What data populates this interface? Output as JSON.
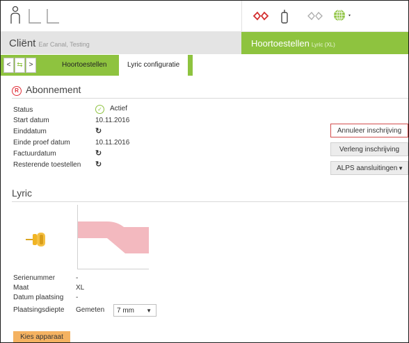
{
  "header": {
    "icons": [
      "person-icon",
      "left-ear-icon",
      "right-ear-icon",
      "hearing-aid-pair-icon",
      "remote-control-icon",
      "hearing-aid-pair-outline-icon",
      "globe-icon"
    ]
  },
  "client": {
    "label": "Cliënt",
    "sub": "Ear Canal, Testing"
  },
  "device": {
    "label": "Hoortoestellen",
    "sub": "Lyric (XL)"
  },
  "nav": {
    "back": "<",
    "swap": "⇆",
    "forward": ">"
  },
  "tabs": [
    {
      "label": "Hoortoestellen",
      "active": false
    },
    {
      "label": "Lyric configuratie",
      "active": true
    }
  ],
  "subscription": {
    "title": "Abonnement",
    "rows": [
      {
        "label": "Status",
        "value": "Actief"
      },
      {
        "label": "Start datum",
        "value": "10.11.2016"
      },
      {
        "label": "Einddatum",
        "value": ""
      },
      {
        "label": "Einde proef datum",
        "value": "10.11.2016"
      },
      {
        "label": "Factuurdatum",
        "value": ""
      },
      {
        "label": "Resterende toestellen",
        "value": ""
      }
    ],
    "buttons": {
      "cancel": "Annuleer inschrijving",
      "extend": "Verleng inschrijving",
      "alps": "ALPS aansluitingen"
    }
  },
  "lyric": {
    "title": "Lyric",
    "fields": [
      {
        "label": "Serienummer",
        "value": "-"
      },
      {
        "label": "Maat",
        "value": "XL"
      },
      {
        "label": "Datum plaatsing",
        "value": "-"
      },
      {
        "label": "Plaatsingsdiepte",
        "value": "Gemeten"
      }
    ],
    "depth_select": "7 mm",
    "choose_button": "Kies apparaat"
  },
  "colors": {
    "accent_green": "#8ec33f",
    "alert_red": "#e0303a",
    "button_orange": "#f4b261"
  }
}
